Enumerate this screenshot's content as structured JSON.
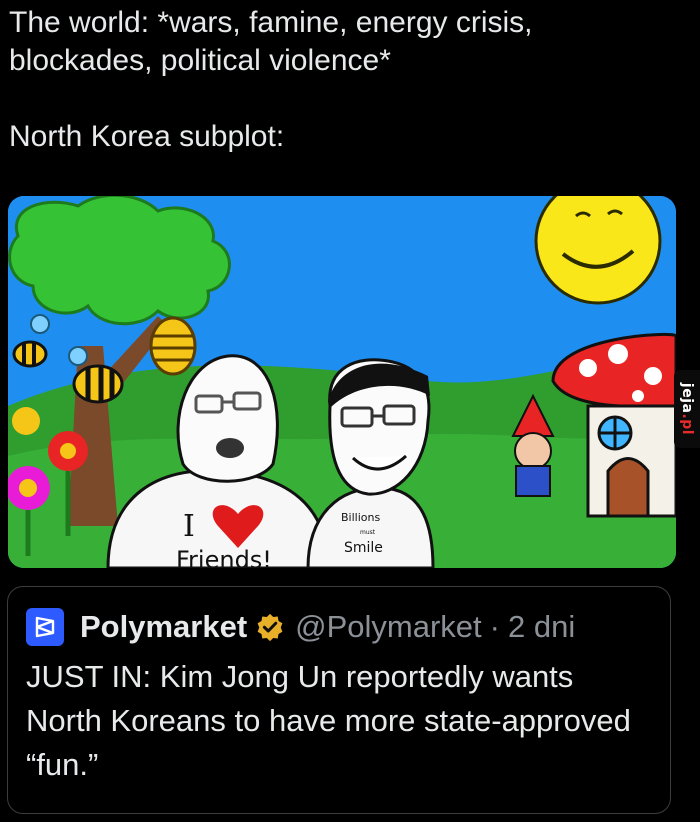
{
  "caption": {
    "line1": "The world: *wars, famine, energy crisis,",
    "line2": "blockades, political violence*",
    "line3": "North Korea subplot:"
  },
  "meme_image": {
    "shirt_left_text": "Friends!",
    "shirt_right_line1": "Billions",
    "shirt_right_line2": "must",
    "shirt_right_line3": "Smile"
  },
  "watermark": {
    "text_a": "jeja",
    "text_b": ".pl"
  },
  "quoted_post": {
    "account_name": "Polymarket",
    "handle": "@Polymarket",
    "separator": "·",
    "time": "2 dni",
    "text": "JUST IN: Kim Jong Un reportedly wants North Koreans to have more state-approved “fun.”"
  },
  "colors": {
    "background": "#000000",
    "text": "#e7e9ea",
    "muted": "#8b9197",
    "verified_badge": "#e8b028",
    "avatar": "#2e5bff",
    "sky": "#1e90ff",
    "grass": "#2f9e2f"
  }
}
